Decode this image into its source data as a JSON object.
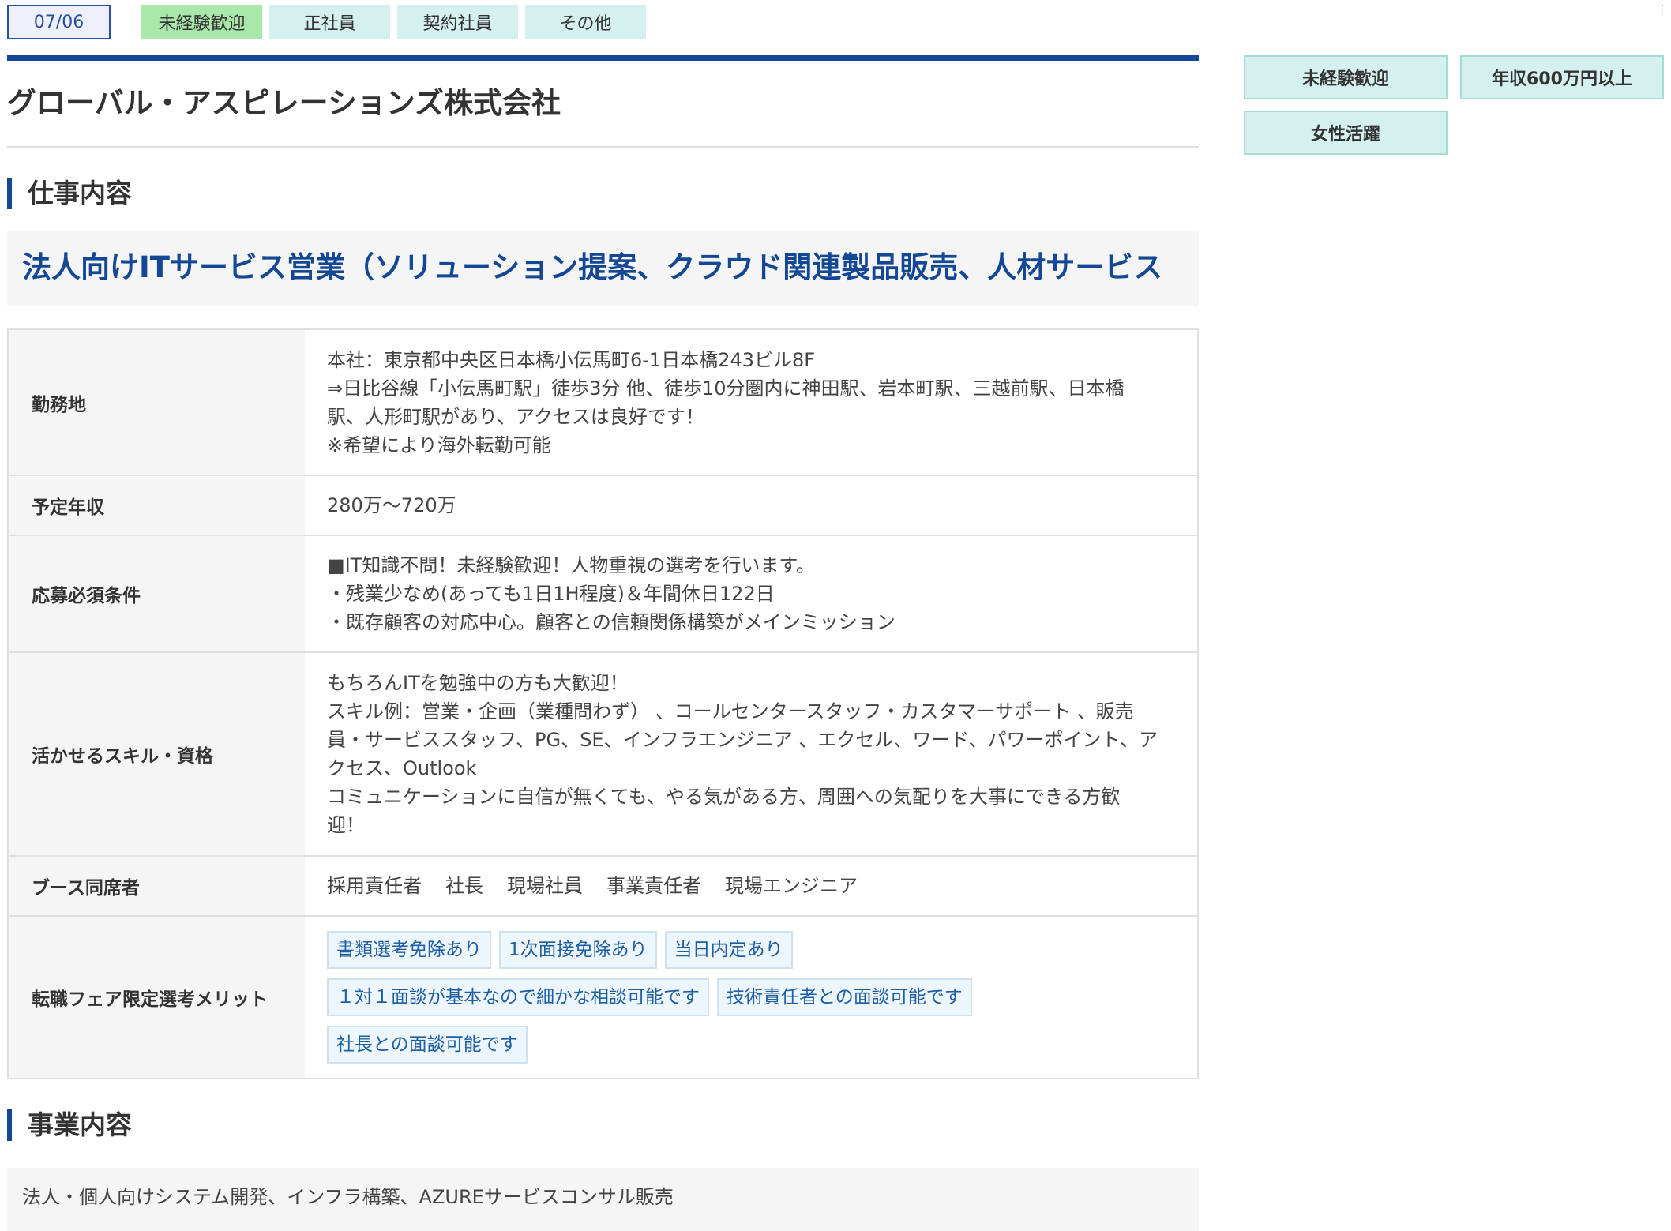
{
  "header": {
    "date": "07/06",
    "tags": [
      "未経験歓迎",
      "正社員",
      "契約社員",
      "その他"
    ]
  },
  "company": {
    "name": "グローバル・アスピレーションズ株式会社"
  },
  "job_section": {
    "heading": "仕事内容",
    "title": "法人向けITサービス営業（ソリューション提案、クラウド関連製品販売、人材サービス"
  },
  "details": {
    "location": {
      "label": "勤務地",
      "lines": [
        "本社：東京都中央区日本橋小伝馬町6-1日本橋243ビル8F",
        "⇒日比谷線「小伝馬町駅」徒歩3分 他、徒歩10分圏内に神田駅、岩本町駅、三越前駅、日本橋",
        "駅、人形町駅があり、アクセスは良好です！",
        "※希望により海外転勤可能"
      ]
    },
    "salary": {
      "label": "予定年収",
      "value": "280万～720万"
    },
    "requirements": {
      "label": "応募必須条件",
      "lines": [
        "■IT知識不問！未経験歓迎！人物重視の選考を行います。",
        "・残業少なめ(あっても1日1H程度)＆年間休日122日",
        "・既存顧客の対応中心。顧客との信頼関係構築がメインミッション"
      ]
    },
    "skills": {
      "label": "活かせるスキル・資格",
      "lines": [
        "もちろんITを勉強中の方も大歓迎！",
        "スキル例：営業・企画（業種問わず） 、コールセンタースタッフ・カスタマーサポート 、販売",
        "員・サービススタッフ、PG、SE、インフラエンジニア 、エクセル、ワード、パワーポイント、ア",
        "クセス、Outlook",
        "コミュニケーションに自信が無くても、やる気がある方、周囲への気配りを大事にできる方歓",
        "迎！"
      ]
    },
    "booth": {
      "label": "ブース同席者",
      "items": [
        "採用責任者",
        "社長",
        "現場社員",
        "事業責任者",
        "現場エンジニア"
      ]
    },
    "merits": {
      "label": "転職フェア限定選考メリット",
      "items": [
        "書類選考免除あり",
        "1次面接免除あり",
        "当日内定あり",
        "１対１面談が基本なので細かな相談可能です",
        "技術責任者との面談可能です",
        "社長との面談可能です"
      ]
    }
  },
  "business": {
    "heading": "事業内容",
    "text": "法人・個人向けシステム開発、インフラ構築、AZUREサービスコンサル販売"
  },
  "sidebar": {
    "tags": [
      "未経験歓迎",
      "年収600万円以上",
      "女性活躍"
    ]
  },
  "colors": {
    "brand_blue": "#144894",
    "tag_green": "#a9e7ab",
    "tag_light": "#d5f1ef"
  }
}
